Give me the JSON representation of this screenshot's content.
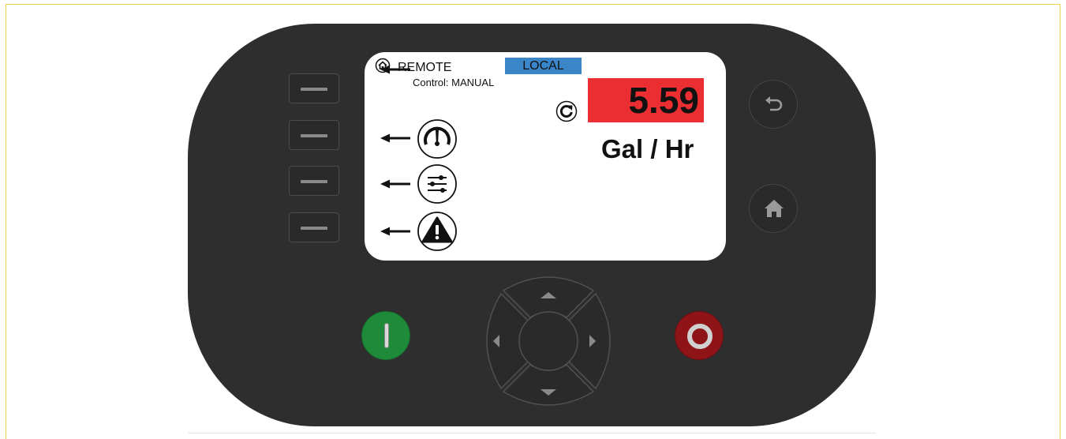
{
  "screen": {
    "remote_label": "REMOTE",
    "control_mode": "Control: MANUAL",
    "local_badge": "LOCAL",
    "flow_value": "5.59",
    "flow_units": "Gal / Hr"
  },
  "menu_icons": [
    "home-icon",
    "gauge-icon",
    "settings-sliders-icon",
    "alarm-warning-icon",
    "refresh-icon"
  ],
  "colors": {
    "panel": "#2e2e2e",
    "local_badge": "#3a86c8",
    "readout_bg": "#ea2e31",
    "start_button": "#1f8a3a",
    "stop_button": "#8e1418"
  }
}
